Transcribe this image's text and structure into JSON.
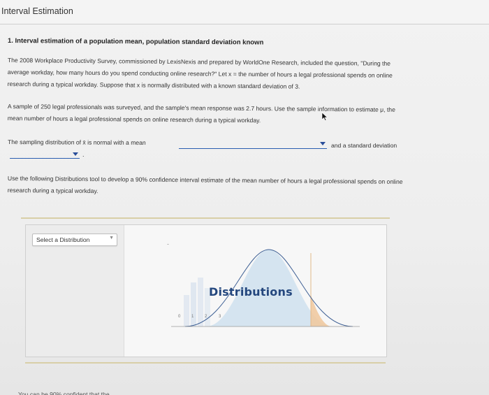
{
  "page": {
    "title": "Interval Estimation"
  },
  "question": {
    "heading": "1. Interval estimation of a population mean, population standard deviation known",
    "paragraph1_line1": "The 2008 Workplace Productivity Survey, commissioned by LexisNexis and prepared by WorldOne Research, included the question, \"During the",
    "paragraph1_line2": "average workday, how many hours do you spend conducting online research?\" Let x = the number of hours a legal professional spends on online",
    "paragraph1_line3": "research during a typical workday. Suppose that x is normally distributed with a known standard deviation of 3.",
    "paragraph2_line1": "A sample of 250 legal professionals was surveyed, and the sample's mean response was 2.7 hours. Use the sample information to estimate μ, the",
    "paragraph2_line2": "mean number of hours a legal professional spends on online research during a typical workday.",
    "sampling_prefix": "The sampling distribution of x̄  is normal with a mean",
    "sampling_middle": "and a standard deviation",
    "mean_dropdown_value": "",
    "sd_dropdown_value": "",
    "period": ".",
    "paragraph4_line1": "Use the following Distributions tool to develop a 90% confidence interval estimate of the mean number of hours a legal professional spends on online",
    "paragraph4_line2": "research during a typical workday."
  },
  "tool": {
    "select_label": "Select a Distribution",
    "caret": "▼",
    "dash": "-",
    "graphic_title": "Distributions",
    "axis_ticks": [
      "0",
      "1",
      "2",
      "3"
    ],
    "bottom_cut_text": "You can be 90% confident that the"
  },
  "colors": {
    "link_blue": "#2a5db0",
    "brand_blue": "#24477e",
    "curve_fill": "#cfe0ef",
    "tail_fill": "#f0c9a0",
    "bars": "#dfe7f0",
    "divider": "#d8cfa7"
  }
}
